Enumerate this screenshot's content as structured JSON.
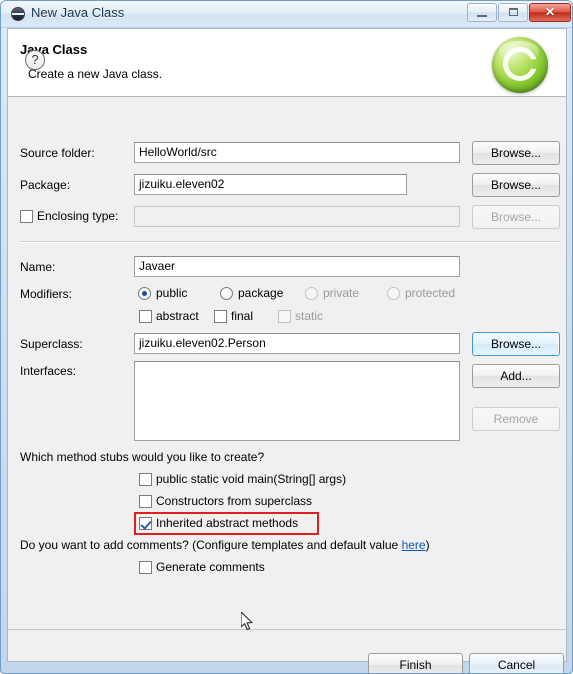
{
  "window": {
    "title": "New Java Class",
    "icon": "java-class-icon",
    "controls": {
      "minimize": "minimize-icon",
      "maximize": "maximize-icon",
      "close": "✕"
    }
  },
  "header": {
    "title": "Java Class",
    "subtitle": "Create a new Java class.",
    "banner_icon": "java-class-banner-icon"
  },
  "form": {
    "source_folder": {
      "label": "Source folder:",
      "value": "HelloWorld/src",
      "placeholder": "",
      "browse_label": "Browse..."
    },
    "package": {
      "label": "Package:",
      "value": "jizuiku.eleven02",
      "placeholder": "",
      "browse_label": "Browse..."
    },
    "enclosing_type": {
      "label": "Enclosing type:",
      "value": "",
      "placeholder": "",
      "checked": false,
      "enabled": false,
      "browse_label": "Browse..."
    },
    "name": {
      "label": "Name:",
      "value": "Javaer",
      "placeholder": ""
    },
    "modifiers": {
      "label": "Modifiers:",
      "access": [
        {
          "label": "public",
          "selected": true,
          "enabled": true
        },
        {
          "label": "package",
          "selected": false,
          "enabled": true
        },
        {
          "label": "private",
          "selected": false,
          "enabled": false
        },
        {
          "label": "protected",
          "selected": false,
          "enabled": false
        }
      ],
      "flags": [
        {
          "label": "abstract",
          "checked": false,
          "enabled": true
        },
        {
          "label": "final",
          "checked": false,
          "enabled": true
        },
        {
          "label": "static",
          "checked": false,
          "enabled": false
        }
      ]
    },
    "superclass": {
      "label": "Superclass:",
      "value": "jizuiku.eleven02.Person",
      "placeholder": "",
      "browse_label": "Browse...",
      "focused": true
    },
    "interfaces": {
      "label": "Interfaces:",
      "items": [],
      "add_label": "Add...",
      "remove_label": "Remove",
      "remove_enabled": false
    }
  },
  "stubs": {
    "question": "Which method stubs would you like to create?",
    "options": [
      {
        "label": "public static void main(String[] args)",
        "checked": false
      },
      {
        "label": "Constructors from superclass",
        "checked": false
      },
      {
        "label": "Inherited abstract methods",
        "checked": true,
        "highlighted": true
      }
    ]
  },
  "comments": {
    "question_prefix": "Do you want to add comments? (Configure templates and default value ",
    "link_label": "here",
    "question_suffix": ")",
    "option": {
      "label": "Generate comments",
      "checked": false
    }
  },
  "footer": {
    "help_icon": "?",
    "finish_label": "Finish",
    "cancel_label": "Cancel"
  },
  "annotation": {
    "color": "#e02020",
    "target": "Inherited abstract methods"
  }
}
